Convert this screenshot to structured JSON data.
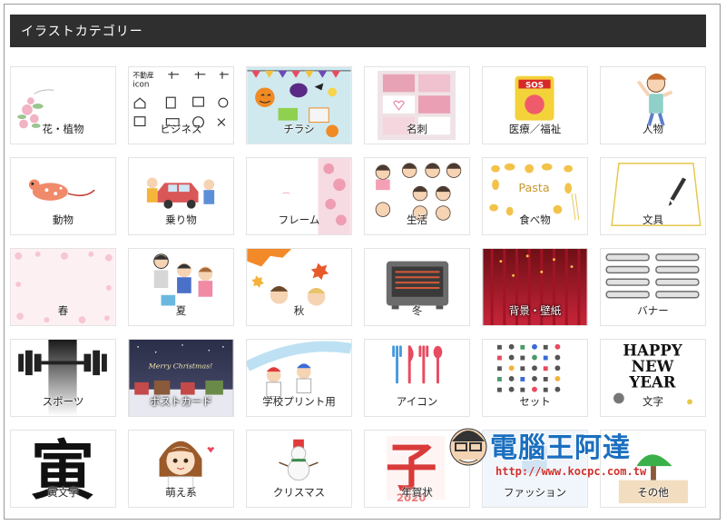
{
  "header": {
    "title": "イラストカテゴリー"
  },
  "tiles": [
    {
      "label": "花・植物",
      "icon": "flower-icon"
    },
    {
      "label": "ビジネス",
      "icon": "business-icons"
    },
    {
      "label": "チラシ",
      "icon": "flyer-icon"
    },
    {
      "label": "名刺",
      "icon": "business-card-icon"
    },
    {
      "label": "医療／福祉",
      "icon": "sos-icon"
    },
    {
      "label": "人物",
      "icon": "person-icon"
    },
    {
      "label": "動物",
      "icon": "mouse-icon"
    },
    {
      "label": "乗り物",
      "icon": "car-icon"
    },
    {
      "label": "フレーム",
      "icon": "frame-icon"
    },
    {
      "label": "生活",
      "icon": "faces-icon"
    },
    {
      "label": "食べ物",
      "icon": "pasta-icon"
    },
    {
      "label": "文具",
      "icon": "pen-icon"
    },
    {
      "label": "春",
      "icon": "spring-icon"
    },
    {
      "label": "夏",
      "icon": "summer-icon"
    },
    {
      "label": "秋",
      "icon": "autumn-leaves-icon"
    },
    {
      "label": "冬",
      "icon": "heater-icon"
    },
    {
      "label": "背景・壁紙",
      "icon": "curtain-icon"
    },
    {
      "label": "バナー",
      "icon": "banner-icon"
    },
    {
      "label": "スポーツ",
      "icon": "dumbbell-icon"
    },
    {
      "label": "ポストカード",
      "icon": "postcard-icon"
    },
    {
      "label": "学校プリント用",
      "icon": "school-icon"
    },
    {
      "label": "アイコン",
      "icon": "cutlery-icon"
    },
    {
      "label": "セット",
      "icon": "icon-set-icon"
    },
    {
      "label": "文字",
      "icon": "text-icon"
    },
    {
      "label": "寅文字",
      "icon": "tiger-kanji-icon"
    },
    {
      "label": "萌え系",
      "icon": "cute-girl-icon"
    },
    {
      "label": "クリスマス",
      "icon": "snowman-icon"
    },
    {
      "label": "年賀状",
      "icon": "new-year-card-icon"
    },
    {
      "label": "ファッション",
      "icon": "fashion-icon"
    },
    {
      "label": "その他",
      "icon": "tree-icon"
    }
  ],
  "tile_text": {
    "business": "不動産",
    "business2": "icon",
    "postcard": "Merry Christmas!",
    "pasta": "Pasta",
    "happy": "HAPPY",
    "new": "NEW",
    "year": "YEAR",
    "tiger": "寅",
    "card_kanji": "子",
    "sos": "SOS",
    "year_num": "2020"
  },
  "watermark": {
    "title": "電腦王阿達",
    "url": "http://www.kocpc.com.tw"
  },
  "colors": {
    "header_bg": "#2f2f2f",
    "watermark_blue": "#1a6fbf",
    "watermark_red": "#d0312d"
  }
}
